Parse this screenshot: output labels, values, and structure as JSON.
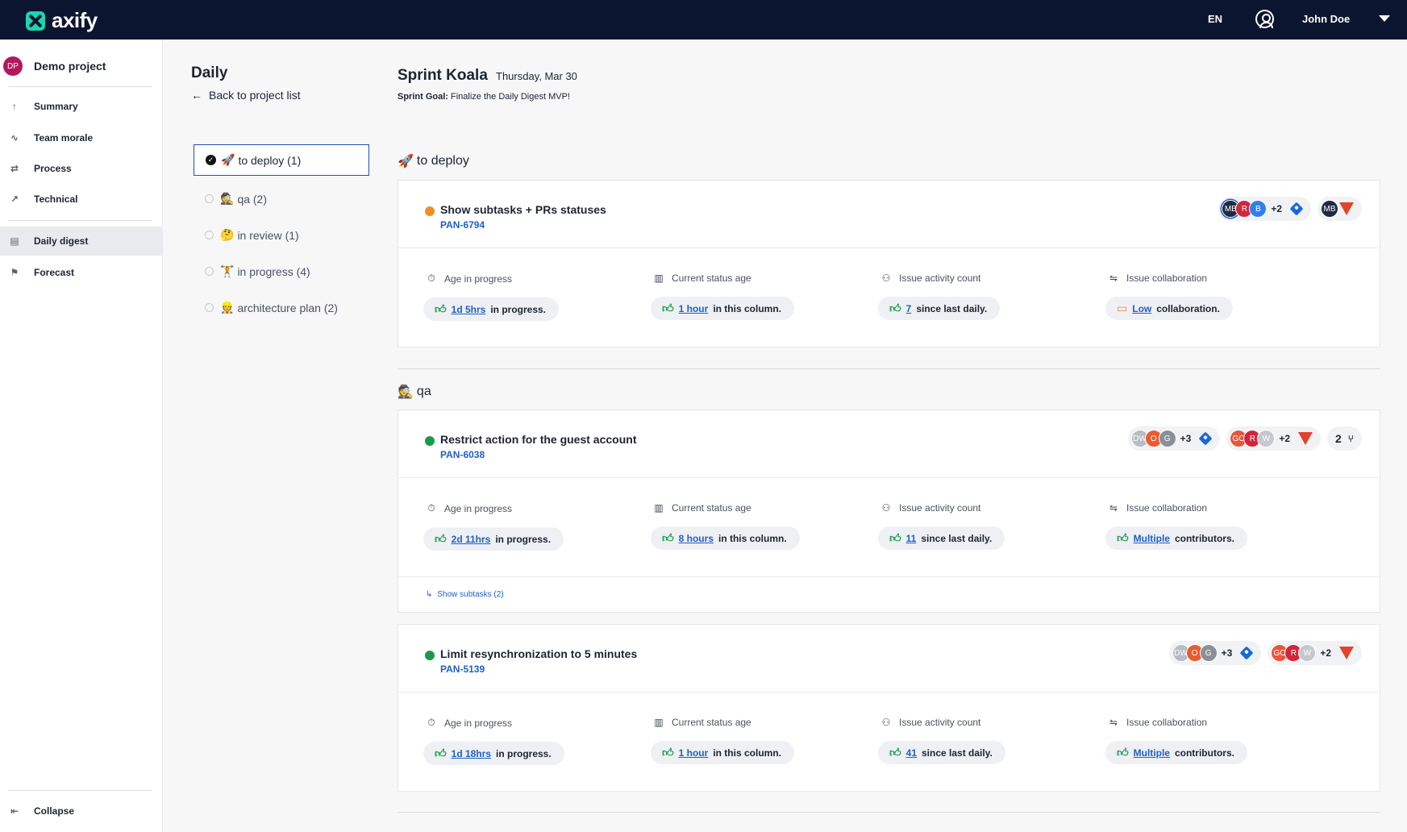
{
  "app": {
    "brand": "axify",
    "language": "EN",
    "user_name": "John Doe"
  },
  "sidebar": {
    "project_initials": "DP",
    "project_name": "Demo project",
    "items": [
      {
        "label": "Summary",
        "icon": "summary-icon"
      },
      {
        "label": "Team morale",
        "icon": "morale-icon"
      },
      {
        "label": "Process",
        "icon": "process-icon"
      },
      {
        "label": "Technical",
        "icon": "technical-icon"
      },
      {
        "label": "Daily digest",
        "icon": "daily-digest-icon"
      },
      {
        "label": "Forecast",
        "icon": "forecast-icon"
      }
    ],
    "collapse_label": "Collapse"
  },
  "page": {
    "title": "Daily",
    "back_label": "Back to project list"
  },
  "sections": [
    {
      "emoji": "🚀",
      "label": "to deploy (1)",
      "selected": true
    },
    {
      "emoji": "🕵️",
      "label": "qa (2)"
    },
    {
      "emoji": "🤔",
      "label": "in review (1)"
    },
    {
      "emoji": "🏋️",
      "label": "in progress (4)"
    },
    {
      "emoji": "👷",
      "label": "architecture plan (2)"
    }
  ],
  "sprint": {
    "name": "Sprint Koala",
    "date": "Thursday, Mar 30",
    "goal_label": "Sprint Goal:",
    "goal_text": "Finalize the Daily Digest MVP!"
  },
  "metric_labels": {
    "age": "Age in progress",
    "status_age": "Current status age",
    "activity": "Issue activity count",
    "collab": "Issue collaboration"
  },
  "groups": [
    {
      "emoji": "🚀",
      "name": "to deploy"
    },
    {
      "emoji": "🕵️",
      "name": "qa"
    }
  ],
  "issues": [
    {
      "title": "Show subtasks + PRs statuses",
      "key": "PAN-6794",
      "status_color": "#f28c28",
      "assignees": [
        {
          "i": "MB",
          "c": "#1f2a44"
        },
        {
          "i": "R",
          "c": "#d3263a"
        },
        {
          "i": "B",
          "c": "#2f80ed"
        }
      ],
      "assignees_more": "+2",
      "reviewers": [
        {
          "i": "MB",
          "c": "#1f2a44"
        }
      ],
      "age_value": "1d 5hrs",
      "age_suffix": "in progress.",
      "status_value": "1 hour",
      "status_suffix": "in this column.",
      "activity_value": "7",
      "activity_suffix": "since last daily.",
      "collab_value": "Low",
      "collab_suffix": "collaboration."
    },
    {
      "title": "Restrict action for the guest account",
      "key": "PAN-6038",
      "status_color": "#1a9a48",
      "assignees": [
        {
          "i": "DW",
          "c": "#b8bcc4"
        },
        {
          "i": "O",
          "c": "#e85b2f"
        },
        {
          "i": "G",
          "c": "#8a8f98"
        }
      ],
      "assignees_more": "+3",
      "reviewers": [
        {
          "i": "GO",
          "c": "#e8553a"
        },
        {
          "i": "R",
          "c": "#d3263a"
        },
        {
          "i": "W",
          "c": "#c5c8ce"
        }
      ],
      "reviewers_more": "+2",
      "branch_count": "2",
      "age_value": "2d 11hrs",
      "age_suffix": "in progress.",
      "status_value": "8 hours",
      "status_suffix": "in this column.",
      "activity_value": "11",
      "activity_suffix": "since last daily.",
      "collab_value": "Multiple",
      "collab_suffix": "contributors.",
      "subtasks_label": "Show subtasks (2)"
    },
    {
      "title": "Limit resynchronization to 5 minutes",
      "key": "PAN-5139",
      "status_color": "#1a9a48",
      "assignees": [
        {
          "i": "DW",
          "c": "#b8bcc4"
        },
        {
          "i": "O",
          "c": "#e85b2f"
        },
        {
          "i": "G",
          "c": "#8a8f98"
        }
      ],
      "assignees_more": "+3",
      "reviewers": [
        {
          "i": "GO",
          "c": "#e8553a"
        },
        {
          "i": "R",
          "c": "#d3263a"
        },
        {
          "i": "W",
          "c": "#c5c8ce"
        }
      ],
      "reviewers_more": "+2",
      "age_value": "1d 18hrs",
      "age_suffix": "in progress.",
      "status_value": "1 hour",
      "status_suffix": "in this column.",
      "activity_value": "41",
      "activity_suffix": "since last daily.",
      "collab_value": "Multiple",
      "collab_suffix": "contributors."
    }
  ]
}
